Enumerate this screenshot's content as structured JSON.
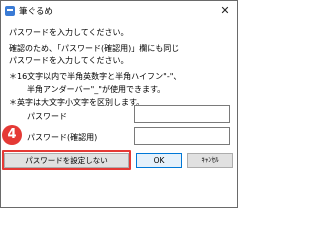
{
  "window": {
    "title": "筆ぐるめ"
  },
  "message": {
    "line1": "パスワードを入力してください。",
    "line2": "確認のため、「パスワード(確認用)」欄にも同じ",
    "line3": "パスワードを入力してください。",
    "note1": "＊16文字以内で半角英数字と半角ハイフン\"-\"、",
    "note2": "半角アンダーバー\"_\"が使用できます。",
    "note3": "＊英字は大文字小文字を区別します。"
  },
  "fields": {
    "password_label": "パスワード",
    "password_value": "",
    "confirm_label": "パスワード(確認用)",
    "confirm_value": ""
  },
  "buttons": {
    "no_password": "パスワードを設定しない",
    "ok": "OK",
    "cancel": "ｷｬﾝｾﾙ"
  },
  "annotation": {
    "step": "4",
    "accent_color": "#e53935"
  }
}
